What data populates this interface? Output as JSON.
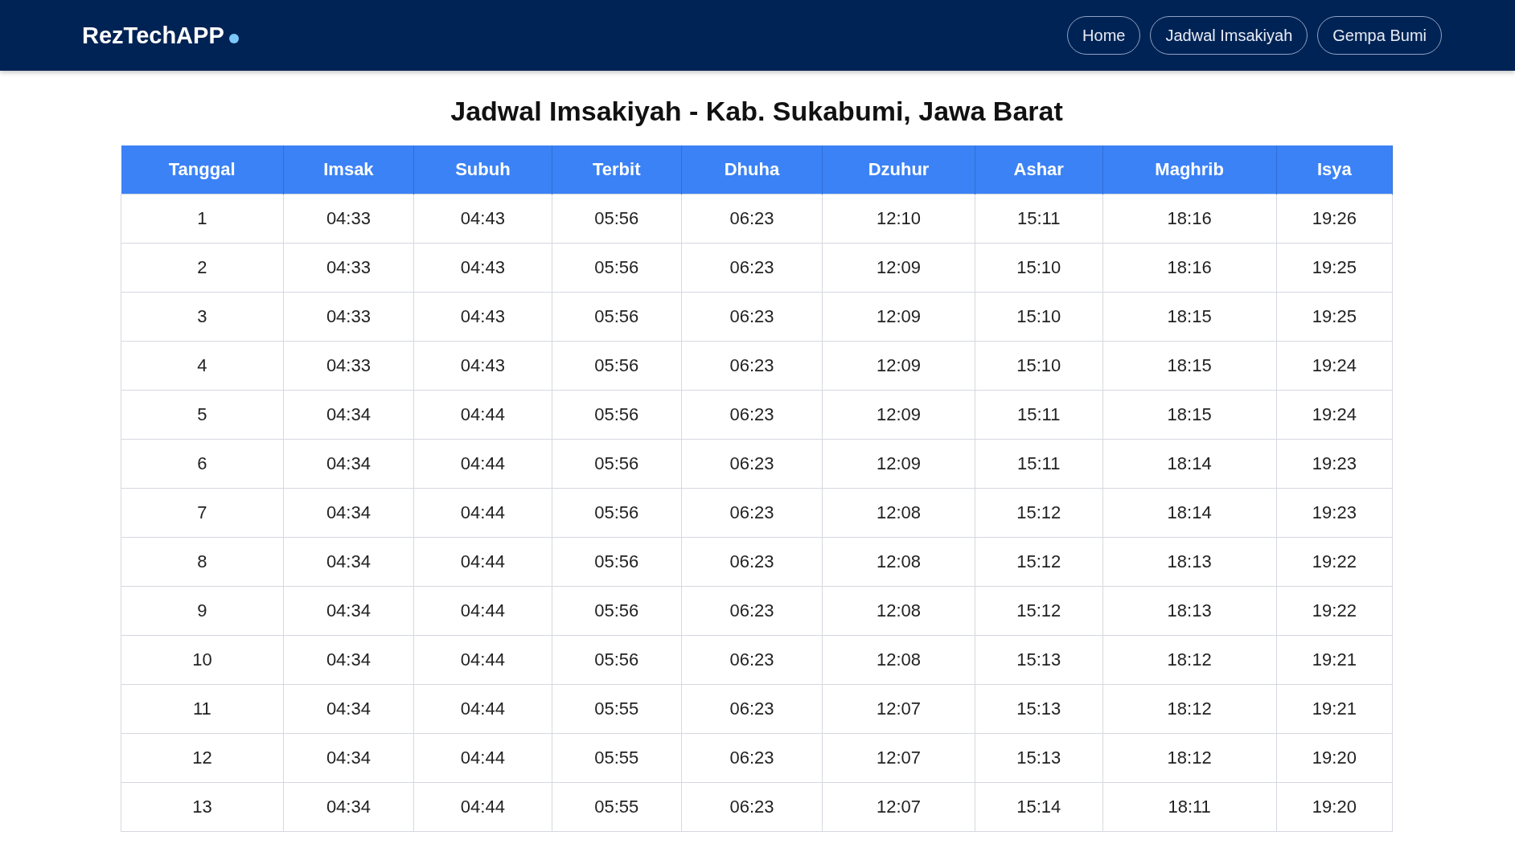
{
  "navbar": {
    "brand": "RezTechAPP",
    "links": [
      {
        "label": "Home"
      },
      {
        "label": "Jadwal Imsakiyah"
      },
      {
        "label": "Gempa Bumi"
      }
    ]
  },
  "title": "Jadwal Imsakiyah - Kab. Sukabumi, Jawa Barat",
  "table": {
    "columns": [
      "Tanggal",
      "Imsak",
      "Subuh",
      "Terbit",
      "Dhuha",
      "Dzuhur",
      "Ashar",
      "Maghrib",
      "Isya"
    ],
    "rows": [
      [
        "1",
        "04:33",
        "04:43",
        "05:56",
        "06:23",
        "12:10",
        "15:11",
        "18:16",
        "19:26"
      ],
      [
        "2",
        "04:33",
        "04:43",
        "05:56",
        "06:23",
        "12:09",
        "15:10",
        "18:16",
        "19:25"
      ],
      [
        "3",
        "04:33",
        "04:43",
        "05:56",
        "06:23",
        "12:09",
        "15:10",
        "18:15",
        "19:25"
      ],
      [
        "4",
        "04:33",
        "04:43",
        "05:56",
        "06:23",
        "12:09",
        "15:10",
        "18:15",
        "19:24"
      ],
      [
        "5",
        "04:34",
        "04:44",
        "05:56",
        "06:23",
        "12:09",
        "15:11",
        "18:15",
        "19:24"
      ],
      [
        "6",
        "04:34",
        "04:44",
        "05:56",
        "06:23",
        "12:09",
        "15:11",
        "18:14",
        "19:23"
      ],
      [
        "7",
        "04:34",
        "04:44",
        "05:56",
        "06:23",
        "12:08",
        "15:12",
        "18:14",
        "19:23"
      ],
      [
        "8",
        "04:34",
        "04:44",
        "05:56",
        "06:23",
        "12:08",
        "15:12",
        "18:13",
        "19:22"
      ],
      [
        "9",
        "04:34",
        "04:44",
        "05:56",
        "06:23",
        "12:08",
        "15:12",
        "18:13",
        "19:22"
      ],
      [
        "10",
        "04:34",
        "04:44",
        "05:56",
        "06:23",
        "12:08",
        "15:13",
        "18:12",
        "19:21"
      ],
      [
        "11",
        "04:34",
        "04:44",
        "05:55",
        "06:23",
        "12:07",
        "15:13",
        "18:12",
        "19:21"
      ],
      [
        "12",
        "04:34",
        "04:44",
        "05:55",
        "06:23",
        "12:07",
        "15:13",
        "18:12",
        "19:20"
      ],
      [
        "13",
        "04:34",
        "04:44",
        "05:55",
        "06:23",
        "12:07",
        "15:14",
        "18:11",
        "19:20"
      ]
    ]
  }
}
